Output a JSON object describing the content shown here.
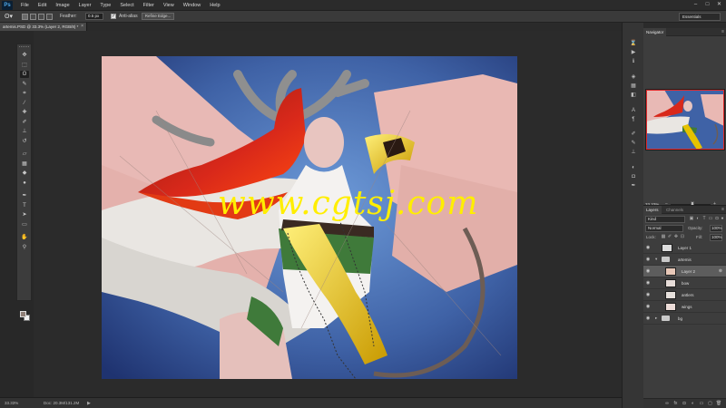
{
  "app": {
    "logo": "Ps",
    "menus": [
      "File",
      "Edit",
      "Image",
      "Layer",
      "Type",
      "Select",
      "Filter",
      "View",
      "Window",
      "Help"
    ],
    "window_controls": [
      "–",
      "□",
      "✕"
    ]
  },
  "options": {
    "feather_label": "Feather:",
    "feather_value": "0.5 px",
    "anti_alias_label": "Anti-alias",
    "anti_alias_checked": true,
    "refine_edge_label": "Refine Edge...",
    "workspace": "Essentials"
  },
  "document": {
    "tab_title": "artemis.PSD @ 33.3% (Layer 2, RGB/8) *",
    "tab_close": "×",
    "watermark": "www.cgtsj.com"
  },
  "status": {
    "zoom": "33.33%",
    "doc_info": "Doc: 20.3M/131.2M",
    "arrow": "▶"
  },
  "navigator": {
    "tab_label": "Navigator",
    "menu": "≡",
    "zoom": "33.33%",
    "minus": "−",
    "plus": "+"
  },
  "layers_panel": {
    "tabs": [
      "Layers",
      "Channels"
    ],
    "menu": "≡",
    "kind": "Kind",
    "blend_mode": "Normal",
    "opacity_label": "Opacity:",
    "opacity_value": "100%",
    "lock_label": "Lock:",
    "fill_label": "Fill:",
    "fill_value": "100%",
    "layers": [
      {
        "name": "Layer 1",
        "thumb": "#dcdcdc",
        "selected": false,
        "folder": false,
        "linked": false,
        "indent": false
      },
      {
        "name": "artemis",
        "thumb": "",
        "selected": false,
        "folder": true,
        "linked": false,
        "indent": false,
        "caret": "▾"
      },
      {
        "name": "Layer 2",
        "thumb": "#e8c8b8",
        "selected": true,
        "folder": false,
        "linked": true,
        "indent": true
      },
      {
        "name": "bow",
        "thumb": "#e6dcd8",
        "selected": false,
        "folder": false,
        "linked": false,
        "indent": true
      },
      {
        "name": "antlers",
        "thumb": "#e6e0dc",
        "selected": false,
        "folder": false,
        "linked": false,
        "indent": true
      },
      {
        "name": "wings",
        "thumb": "#ecdcd8",
        "selected": false,
        "folder": false,
        "linked": false,
        "indent": true
      },
      {
        "name": "bg",
        "thumb": "",
        "selected": false,
        "folder": true,
        "linked": false,
        "indent": false,
        "caret": "▸"
      }
    ],
    "link_glyph": "⊗",
    "eye_glyph": "◉",
    "footer_icons": [
      "link-icon",
      "fx-icon",
      "mask-icon",
      "adjustment-icon",
      "folder-icon",
      "new-layer-icon",
      "trash-icon"
    ],
    "footer_glyphs": [
      "∞",
      "fx",
      "◘",
      "◐",
      "▭",
      "▢",
      "🗑"
    ]
  },
  "colors": {
    "foreground": "#8f7f77",
    "background": "#f2f2f2",
    "accent_selection": "#e0282a"
  },
  "tools": [
    {
      "name": "move-tool-icon",
      "glyph": "✥"
    },
    {
      "name": "marquee-tool-icon",
      "glyph": "⬚"
    },
    {
      "name": "lasso-tool-icon",
      "glyph": "ʘ"
    },
    {
      "name": "quick-select-tool-icon",
      "glyph": "✎"
    },
    {
      "name": "crop-tool-icon",
      "glyph": "⌗"
    },
    {
      "name": "eyedropper-tool-icon",
      "glyph": "⁄"
    },
    {
      "name": "healing-brush-tool-icon",
      "glyph": "✚"
    },
    {
      "name": "brush-tool-icon",
      "glyph": "✐"
    },
    {
      "name": "clone-stamp-tool-icon",
      "glyph": "⊥"
    },
    {
      "name": "history-brush-tool-icon",
      "glyph": "↺"
    },
    {
      "name": "eraser-tool-icon",
      "glyph": "▱"
    },
    {
      "name": "gradient-tool-icon",
      "glyph": "▦"
    },
    {
      "name": "blur-tool-icon",
      "glyph": "◆"
    },
    {
      "name": "dodge-tool-icon",
      "glyph": "●"
    },
    {
      "name": "pen-tool-icon",
      "glyph": "✒"
    },
    {
      "name": "type-tool-icon",
      "glyph": "T"
    },
    {
      "name": "path-select-tool-icon",
      "glyph": "➤"
    },
    {
      "name": "shape-tool-icon",
      "glyph": "▭"
    },
    {
      "name": "hand-tool-icon",
      "glyph": "✋"
    },
    {
      "name": "zoom-tool-icon",
      "glyph": "⚲"
    }
  ],
  "icon_strip": [
    {
      "name": "history-panel-icon",
      "glyph": "⌛"
    },
    {
      "name": "actions-panel-icon",
      "glyph": "▶"
    },
    {
      "name": "info-panel-icon",
      "glyph": "ℹ"
    },
    {
      "name": "color-panel-icon",
      "glyph": "◈"
    },
    {
      "name": "swatches-panel-icon",
      "glyph": "▦"
    },
    {
      "name": "styles-panel-icon",
      "glyph": "◧"
    },
    {
      "name": "character-panel-icon",
      "glyph": "A"
    },
    {
      "name": "paragraph-panel-icon",
      "glyph": "¶"
    },
    {
      "name": "brush-panel-icon",
      "glyph": "✐"
    },
    {
      "name": "brush-presets-icon",
      "glyph": "✎"
    },
    {
      "name": "clone-source-icon",
      "glyph": "⊥"
    },
    {
      "name": "adjustments-panel-icon",
      "glyph": "◐"
    },
    {
      "name": "masks-panel-icon",
      "glyph": "◘"
    },
    {
      "name": "paths-panel-icon",
      "glyph": "✒"
    }
  ]
}
